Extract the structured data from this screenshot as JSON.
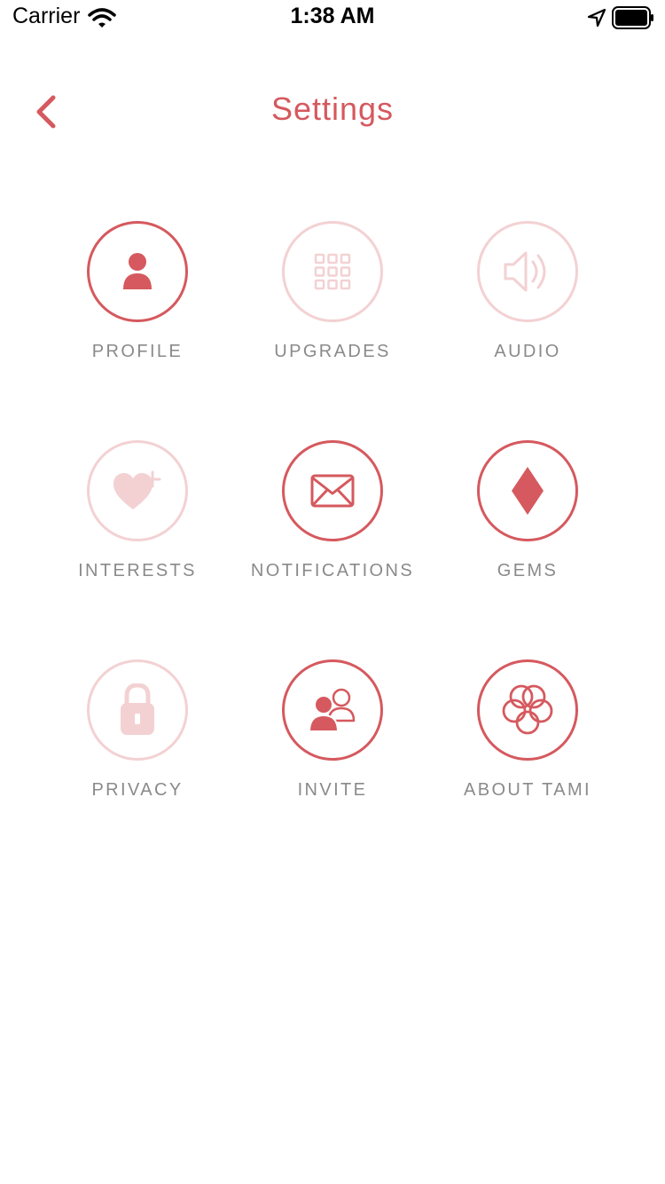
{
  "status_bar": {
    "carrier": "Carrier",
    "time": "1:38 AM"
  },
  "nav": {
    "title": "Settings",
    "back_icon": "chevron-left-icon"
  },
  "colors": {
    "accent": "#d5595e",
    "accent_light": "#f3d1d3",
    "label": "#8a8a8a"
  },
  "tiles": [
    {
      "label": "PROFILE",
      "icon": "person-icon",
      "enabled": true
    },
    {
      "label": "UPGRADES",
      "icon": "grid-icon",
      "enabled": false
    },
    {
      "label": "AUDIO",
      "icon": "speaker-icon",
      "enabled": false
    },
    {
      "label": "INTERESTS",
      "icon": "heart-plus-icon",
      "enabled": false
    },
    {
      "label": "NOTIFICATIONS",
      "icon": "envelope-icon",
      "enabled": true
    },
    {
      "label": "GEMS",
      "icon": "diamond-icon",
      "enabled": true
    },
    {
      "label": "PRIVACY",
      "icon": "lock-icon",
      "enabled": false
    },
    {
      "label": "INVITE",
      "icon": "people-icon",
      "enabled": true
    },
    {
      "label": "ABOUT TAMI",
      "icon": "flower-icon",
      "enabled": true
    }
  ]
}
